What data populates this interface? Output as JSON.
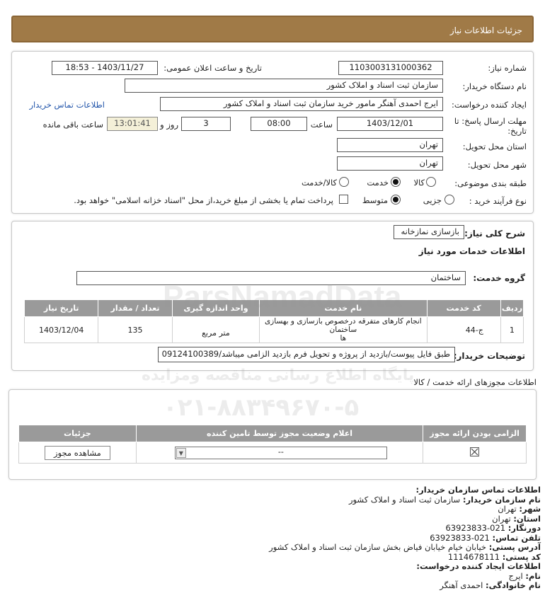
{
  "header": {
    "title": "جزئیات اطلاعات نیاز"
  },
  "info": {
    "need_number_label": "شماره نیاز:",
    "need_number": "1103003131000362",
    "announce_label": "تاریخ و ساعت اعلان عمومی:",
    "announce_value": "1403/11/27 - 18:53",
    "buyer_org_label": "نام دستگاه خریدار:",
    "buyer_org": "سازمان ثبت اسناد و املاک کشور",
    "creator_label": "ایجاد کننده درخواست:",
    "creator": "ایرج احمدی آهنگر مامور خرید سازمان ثبت اسناد و املاک کشور",
    "contact_link": "اطلاعات تماس خریدار",
    "deadline_label_1": "مهلت ارسال پاسخ: تا",
    "deadline_label_2": "تاریخ:",
    "deadline_date": "1403/12/01",
    "time_label": "ساعت",
    "deadline_time": "08:00",
    "days_value": "3",
    "days_label": "روز و",
    "remaining_time": "13:01:41",
    "remaining_label": "ساعت باقی مانده",
    "province_label": "استان محل تحویل:",
    "province": "تهران",
    "city_label": "شهر محل تحویل:",
    "city": "تهران",
    "category_label": "طبقه بندی موضوعی:",
    "category_options": [
      "کالا",
      "خدمت",
      "کالا/خدمت"
    ],
    "category_selected": "خدمت",
    "process_label": "نوع فرآیند خرید :",
    "process_options": [
      "جزیی",
      "متوسط"
    ],
    "process_selected": "متوسط",
    "payment_note": "پرداخت تمام یا بخشی از مبلغ خرید،از محل \"اسناد خزانه اسلامی\" خواهد بود."
  },
  "need": {
    "summary_label": "شرح کلی نیاز:",
    "summary": "بازسازی نمازخانه",
    "services_title": "اطلاعات خدمات مورد نیاز",
    "group_label": "گروه خدمت:",
    "group": "ساختمان",
    "table_headers": [
      "ردیف",
      "کد خدمت",
      "نام خدمت",
      "واحد اندازه گیری",
      "تعداد / مقدار",
      "تاریخ نیاز"
    ],
    "rows": [
      {
        "row": "1",
        "code": "ج-44",
        "name_line1": "انجام کارهای متفرقه درخصوص بازسازی و بهسازی ساختمان",
        "name_line2": "ها",
        "unit": "متر مربع",
        "qty": "135",
        "date": "1403/12/04"
      }
    ],
    "buyer_notes_label": "توضیحات خریدار:",
    "buyer_notes": "طبق فایل پیوست/بازدید از پروژه و تحویل فرم بازدید الزامی میباشد/09124100389"
  },
  "permits": {
    "section_title": "اطلاعات مجوزهای ارائه خدمت / کالا",
    "headers": [
      "الزامی بودن ارائه مجوز",
      "اعلام وضعیت مجوز توسط تامین کننده",
      "جزئیات"
    ],
    "select_value": "--",
    "view_button": "مشاهده مجوز"
  },
  "contact": {
    "title": "اطلاعات تماس سازمان خریدار:",
    "org_label": "نام سازمان خریدار:",
    "org": "سازمان ثبت اسناد و املاک کشور",
    "city_label": "شهر:",
    "city": "تهران",
    "province_label": "استان:",
    "province": "تهران",
    "fax_label": "دورنگار:",
    "fax": "021-63923833",
    "phone_label": "تلفن تماس:",
    "phone": "021-63923833",
    "address_label": "آدرس پستی:",
    "address": "خیابان خیام خیابان فیاض بخش سازمان ثبت اسناد و املاک کشور",
    "postal_label": "کد پستی:",
    "postal": "1114678111",
    "creator_title": "اطلاعات ایجاد کننده درخواست:",
    "name_label": "نام:",
    "name": "ایرج",
    "family_label": "نام خانوادگی:",
    "family": "احمدی آهنگر"
  },
  "watermark": {
    "line1": "پایگاه اطلاع رسانی مناقصه ومزایده",
    "line2": "۰۲۱-۸۸۳۴۹۶۷۰-۵",
    "brand": "ParsNamadData"
  }
}
